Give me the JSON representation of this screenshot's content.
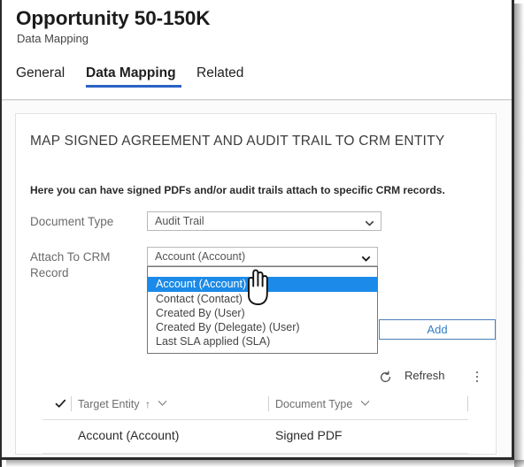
{
  "window": {
    "title": "Opportunity 50-150K",
    "subtitle": "Data Mapping"
  },
  "tabs": [
    {
      "label": "General",
      "active": false
    },
    {
      "label": "Data Mapping",
      "active": true
    },
    {
      "label": "Related",
      "active": false
    }
  ],
  "card": {
    "heading": "MAP SIGNED AGREEMENT AND AUDIT TRAIL TO CRM ENTITY",
    "description": "Here you can have signed PDFs and/or audit trails attach to specific CRM records."
  },
  "form": {
    "document_type": {
      "label": "Document Type",
      "value": "Audit Trail"
    },
    "attach_to_crm_record": {
      "label": "Attach To CRM Record",
      "value": "Account (Account)",
      "expanded": true,
      "options": [
        {
          "label": "",
          "selected": false
        },
        {
          "label": "Account (Account)",
          "selected": true
        },
        {
          "label": "Contact (Contact)",
          "selected": false
        },
        {
          "label": "Created By (User)",
          "selected": false
        },
        {
          "label": "Created By (Delegate) (User)",
          "selected": false
        },
        {
          "label": "Last SLA applied (SLA)",
          "selected": false
        }
      ]
    },
    "add_button": "Add"
  },
  "commandbar": {
    "refresh_label": "Refresh",
    "refresh_icon": "refresh-circular-arrow-icon",
    "more_icon": "more-vertical-ellipsis-icon"
  },
  "grid": {
    "columns": [
      {
        "label": "Target Entity",
        "sort": "↑",
        "caret": "⌄"
      },
      {
        "label": "Document Type",
        "sort": "",
        "caret": "⌄"
      }
    ],
    "select_all_icon": "check-icon",
    "rows": [
      {
        "target_entity": "Account (Account)",
        "document_type": "Signed PDF"
      }
    ]
  },
  "cursor": {
    "icon": "pointing-hand-cursor"
  },
  "colors": {
    "tab_accent": "#2b62c4",
    "highlight": "#1b8ae8",
    "add_border": "#4a80b4",
    "add_text": "#2f7fc6"
  }
}
